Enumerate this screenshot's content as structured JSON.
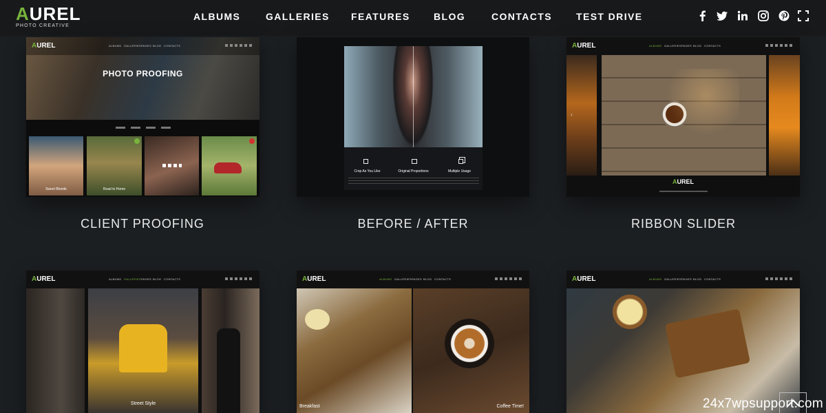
{
  "brand": {
    "name_first": "A",
    "name_rest": "UREL",
    "tagline": "PHOTO CREATIVE"
  },
  "nav": [
    "ALBUMS",
    "GALLERIES",
    "FEATURES",
    "BLOG",
    "CONTACTS",
    "TEST DRIVE"
  ],
  "social": [
    "facebook-icon",
    "twitter-icon",
    "linkedin-icon",
    "instagram-icon",
    "pinterest-icon",
    "fullscreen-icon"
  ],
  "cards": [
    {
      "caption": "CLIENT PROOFING",
      "hero_title": "PHOTO PROOFING",
      "thumbs": [
        "Sweet Blonde",
        "Road to Home"
      ]
    },
    {
      "caption": "BEFORE / AFTER",
      "features": [
        "Crop As You Like",
        "Original Proportions",
        "Multiple Usage"
      ]
    },
    {
      "caption": "RIBBON SLIDER",
      "logo_first": "A",
      "logo_rest": "UREL"
    },
    {
      "caption": "",
      "label": "Street Style"
    },
    {
      "caption": "",
      "label_left": "Breakfast",
      "label_right": "Coffee Time!"
    },
    {
      "caption": ""
    }
  ],
  "mini_nav": [
    "ALBUMS",
    "GALLERIES",
    "PAGES",
    "BLOG",
    "CONTACTS"
  ],
  "watermark": "24x7wpsupport.com"
}
